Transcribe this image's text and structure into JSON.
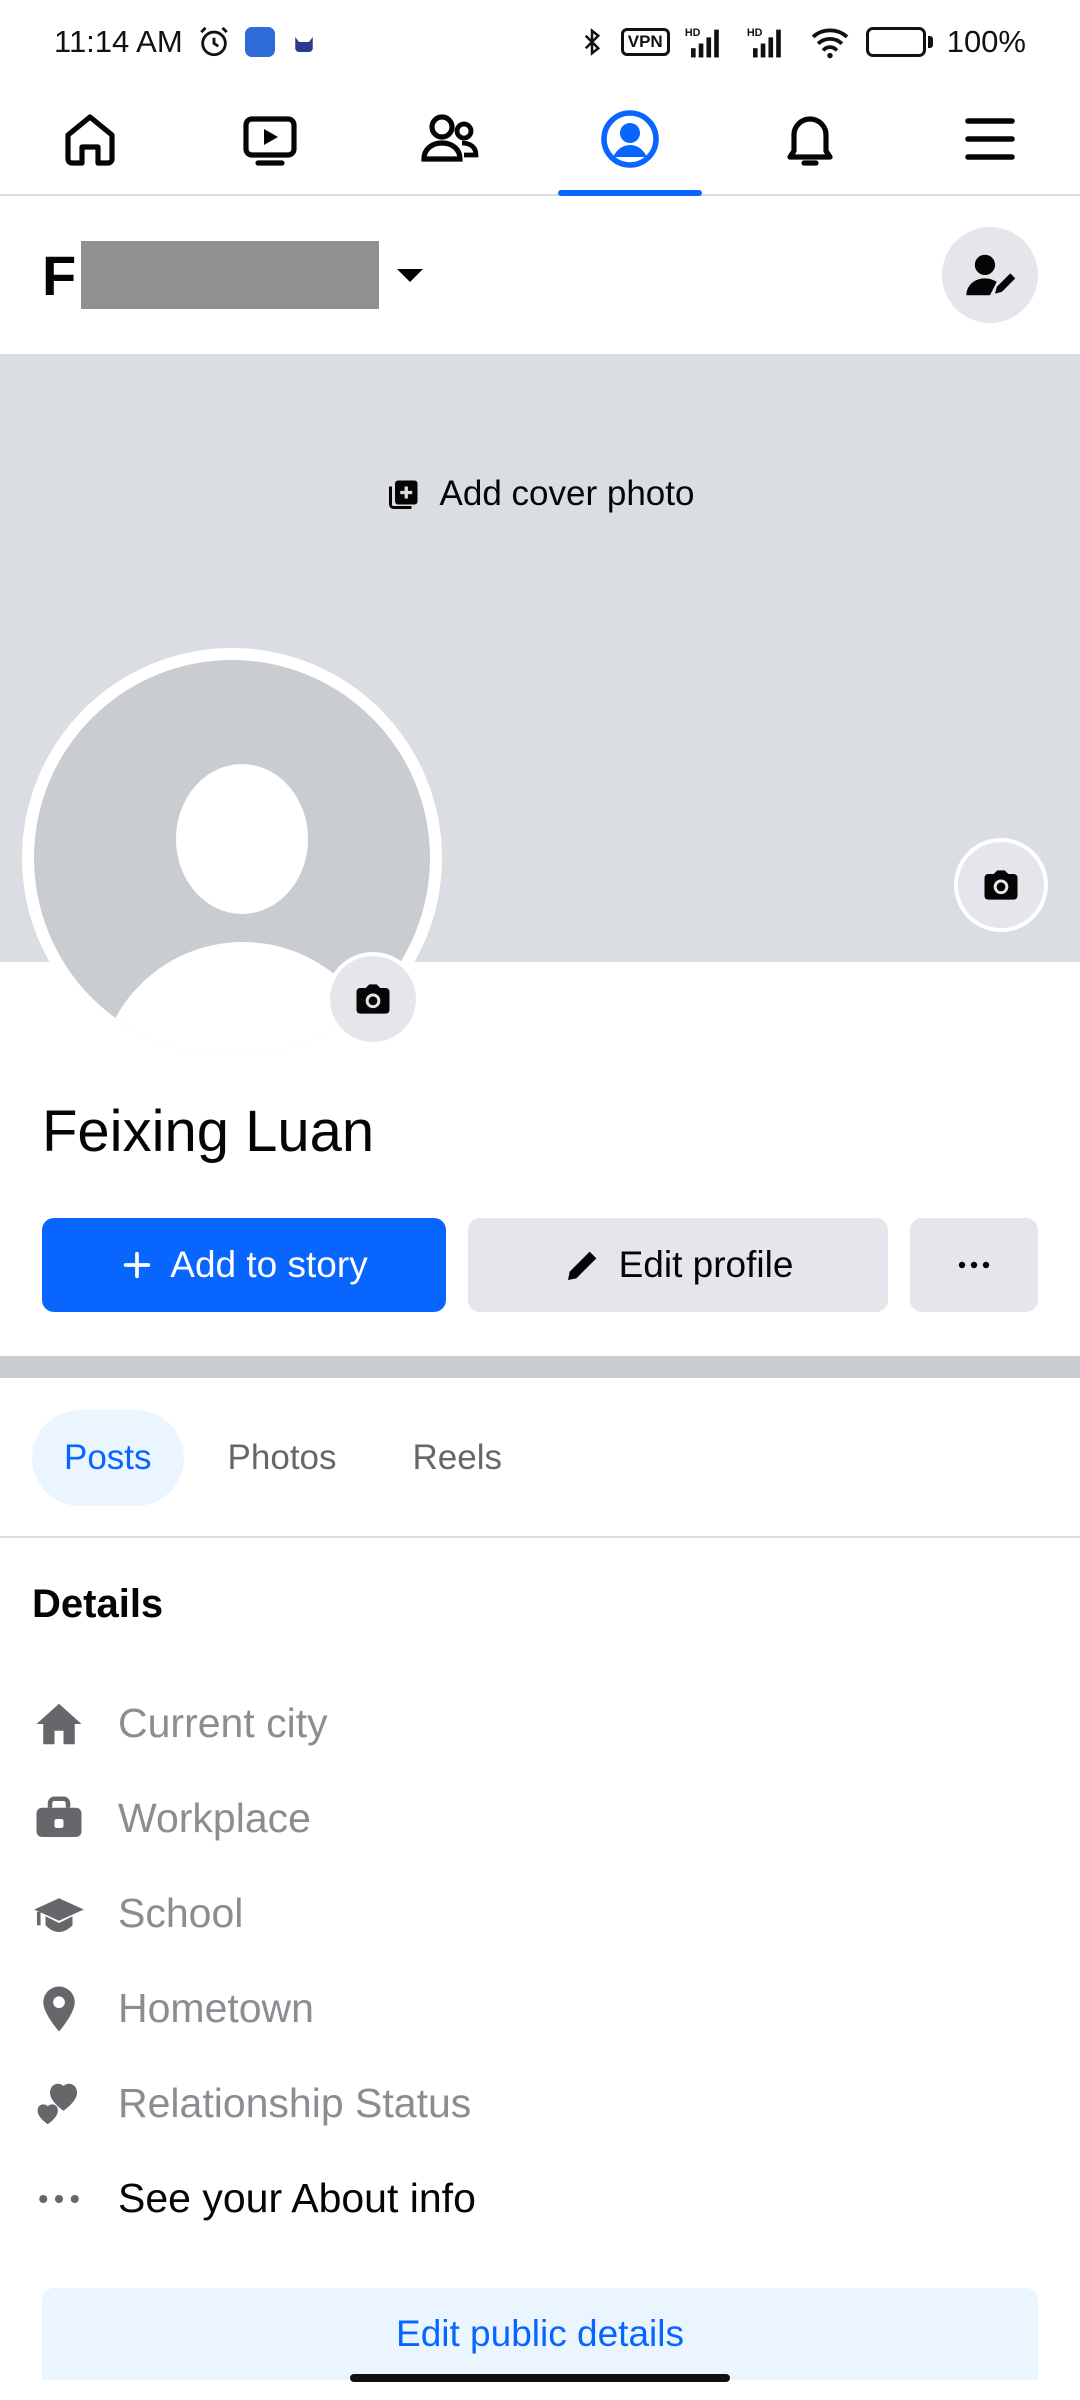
{
  "status_bar": {
    "time": "11:14 AM",
    "vpn": "VPN",
    "battery": "100%"
  },
  "nav": {
    "tabs": [
      {
        "id": "home",
        "icon": "home-icon"
      },
      {
        "id": "video",
        "icon": "video-icon"
      },
      {
        "id": "friends",
        "icon": "friends-icon"
      },
      {
        "id": "profile",
        "icon": "profile-icon",
        "active": true
      },
      {
        "id": "notifications",
        "icon": "bell-icon"
      },
      {
        "id": "menu",
        "icon": "menu-icon"
      }
    ]
  },
  "header": {
    "name_initial": "F"
  },
  "cover": {
    "add_cover_label": "Add cover photo"
  },
  "profile": {
    "name": "Feixing Luan"
  },
  "actions": {
    "add_story": "Add to story",
    "edit_profile": "Edit profile",
    "more": "···"
  },
  "tabs": [
    "Posts",
    "Photos",
    "Reels"
  ],
  "details": {
    "title": "Details",
    "items": [
      {
        "label": "Current city",
        "icon": "house-icon"
      },
      {
        "label": "Workplace",
        "icon": "briefcase-icon"
      },
      {
        "label": "School",
        "icon": "graduation-cap-icon"
      },
      {
        "label": "Hometown",
        "icon": "location-pin-icon"
      },
      {
        "label": "Relationship Status",
        "icon": "heart-icon"
      },
      {
        "label": "See your About info",
        "icon": "more-dots-icon"
      }
    ],
    "edit_public": "Edit public details"
  },
  "colors": {
    "accent": "#0866ff",
    "cover_bg": "#dadde1",
    "button_gray": "#e4e6eb",
    "muted_text": "#8a8d91"
  }
}
